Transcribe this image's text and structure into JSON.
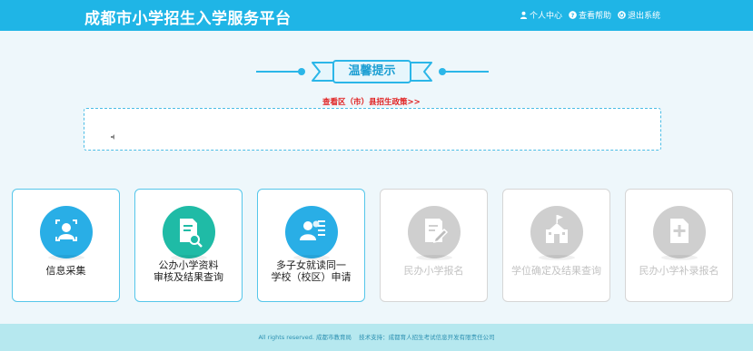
{
  "header": {
    "title": "成都市小学招生入学服务平台",
    "nav": [
      {
        "label": "个人中心",
        "icon": "user-icon"
      },
      {
        "label": "查看帮助",
        "icon": "help-icon"
      },
      {
        "label": "退出系统",
        "icon": "logout-icon"
      }
    ]
  },
  "tips": {
    "title": "温馨提示"
  },
  "policy_link": "查看区（市）县招生政策>>",
  "notice": {
    "icon": "speaker-icon"
  },
  "cards": [
    {
      "label": "信息采集",
      "icon": "info-collect-icon",
      "enabled": true,
      "color": "#29aee6"
    },
    {
      "label": "公办小学资料审核及结果查询",
      "line1": "公办小学资料",
      "line2": "审核及结果查询",
      "icon": "document-search-icon",
      "enabled": true,
      "color": "#1fbba6"
    },
    {
      "label": "多子女就读同一学校（校区）申请",
      "line1": "多子女就读同一",
      "line2": "学校（校区）申请",
      "icon": "multi-child-icon",
      "enabled": true,
      "color": "#29aee6"
    },
    {
      "label": "民办小学报名",
      "icon": "edit-form-icon",
      "enabled": false,
      "color": "#cfcfcf"
    },
    {
      "label": "学位确定及结果查询",
      "icon": "school-building-icon",
      "enabled": false,
      "color": "#cfcfcf"
    },
    {
      "label": "民办小学补录报名",
      "icon": "add-document-icon",
      "enabled": false,
      "color": "#cfcfcf"
    }
  ],
  "footer": {
    "rights": "All rights reserved. 成都市教育局",
    "support": "技术支持：成都育人招生考试信息开发有限责任公司"
  }
}
